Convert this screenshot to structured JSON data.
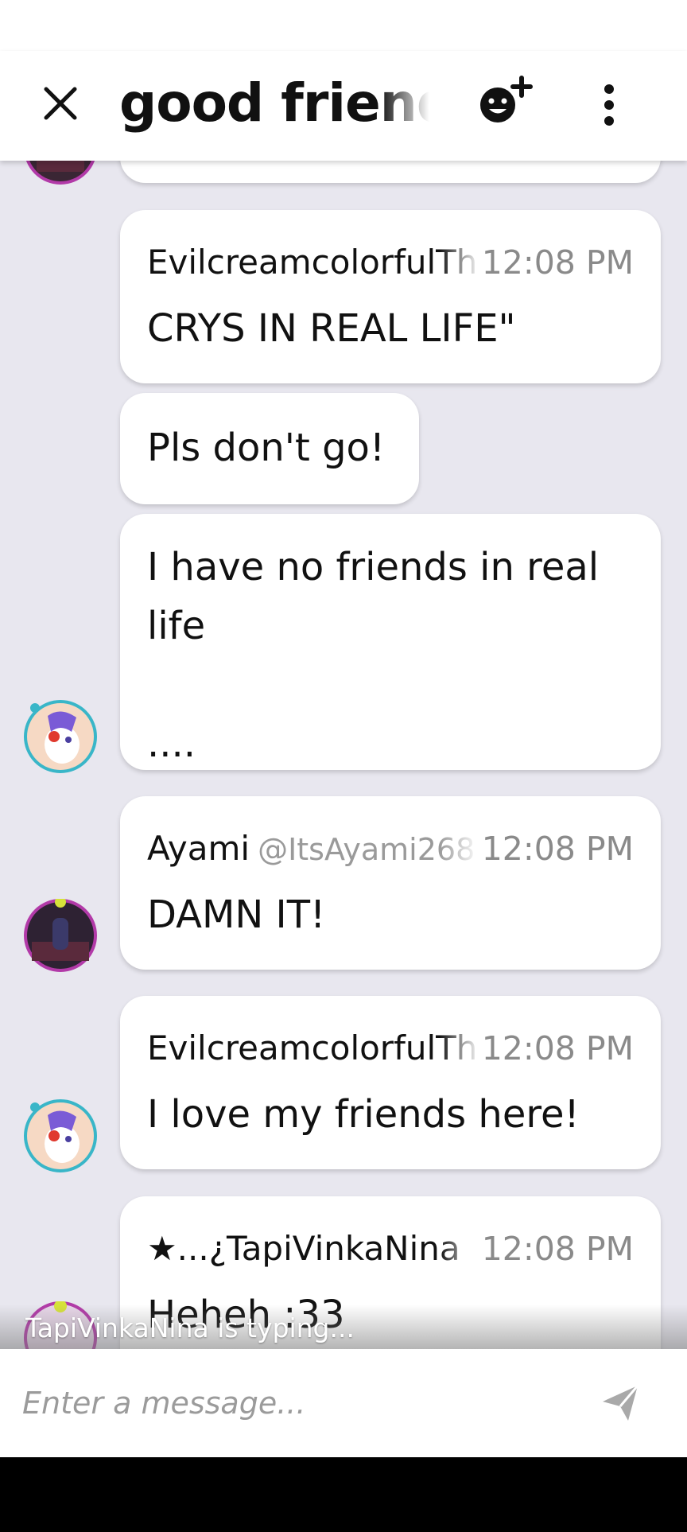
{
  "header": {
    "title": "good friends",
    "close_icon": "close-icon",
    "invite_icon": "add-member-icon",
    "more_icon": "more-vertical-icon"
  },
  "messages": [
    {
      "sender": "",
      "handle": "",
      "time": "",
      "text": ""
    },
    {
      "sender": "EvilcreamcolorfulTheCat",
      "handle": "",
      "time": "12:08 PM",
      "text": "CRYS IN REAL LIFE\""
    },
    {
      "sender": "",
      "handle": "",
      "time": "",
      "text": "Pls don't go!"
    },
    {
      "sender": "",
      "handle": "",
      "time": "",
      "text": "I have no friends in real\nlife\n\n...."
    },
    {
      "sender": "Ayami",
      "handle": "@ItsAyami268",
      "time": "12:08 PM",
      "text": "DAMN IT!"
    },
    {
      "sender": "EvilcreamcolorfulTheCat",
      "handle": "",
      "time": "12:08 PM",
      "text": "I love my friends here!"
    },
    {
      "sender": "★...¿TapiVinkaNina",
      "handle": "",
      "time": "12:08 PM",
      "text": "Heheh :33"
    }
  ],
  "typing": {
    "text": "TapiVinkaNina is typing..."
  },
  "composer": {
    "placeholder": "Enter a message...",
    "send_icon": "send-icon"
  },
  "colors": {
    "background": "#e8e7ef",
    "bubble": "#ffffff",
    "time": "#8a8a8a",
    "handle": "#9a9a9a"
  }
}
